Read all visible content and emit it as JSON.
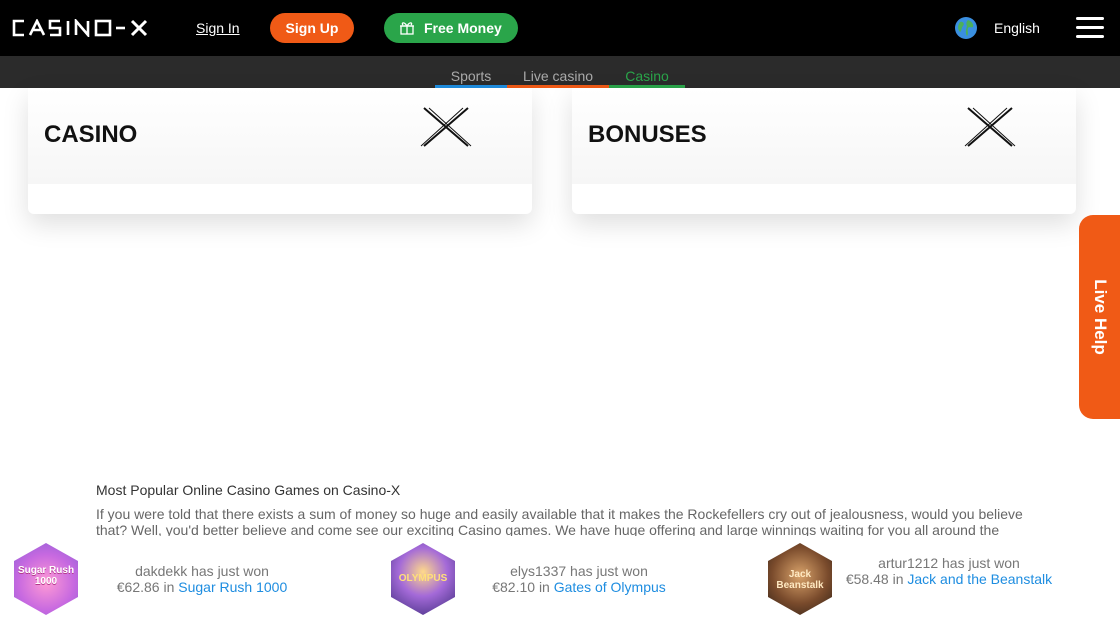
{
  "header": {
    "logo_alt": "CASINO-X",
    "signin_label": "Sign In",
    "signup_label": "Sign Up",
    "freemoney_label": "Free Money",
    "language": "English"
  },
  "subnav": {
    "tabs": [
      {
        "label": "Sports"
      },
      {
        "label": "Live casino"
      },
      {
        "label": "Casino"
      }
    ]
  },
  "cards": [
    {
      "title": "CASINO"
    },
    {
      "title": "BONUSES"
    }
  ],
  "livehelp_label": "Live Help",
  "content": {
    "title": "Most Popular Online Casino Games on Casino-X",
    "text": "If you were told that there exists a sum of money so huge and easily available that it makes the Rockefellers cry out of jealousness, would you believe that? Well, you'd better believe and come see our exciting Casino games. We have huge offering and large winnings waiting for you all around the world."
  },
  "winners": [
    {
      "name": "dakdekk",
      "action": "has just won",
      "amount": "€62.86",
      "in": "in",
      "game": "Sugar Rush 1000",
      "thumb_label": "Sugar Rush 1000"
    },
    {
      "name": "elys1337",
      "action": "has just won",
      "amount": "€82.10",
      "in": "in",
      "game": "Gates of Olympus",
      "thumb_label": "OLYMPUS"
    },
    {
      "name": "artur1212",
      "action": "has just won",
      "amount": "€58.48",
      "in": "in",
      "game": "Jack and the Beanstalk",
      "thumb_label": "Jack Beanstalk"
    }
  ],
  "colors": {
    "brand_orange": "#f05a16",
    "brand_green": "#2aa54a",
    "sports_blue": "#1e8de0",
    "header_bg": "#000000",
    "subnav_bg": "#2b2b2b"
  },
  "icons": [
    "casino-x-logo",
    "gift-icon",
    "globe-icon",
    "hamburger-menu-icon",
    "x-emblem-icon"
  ]
}
